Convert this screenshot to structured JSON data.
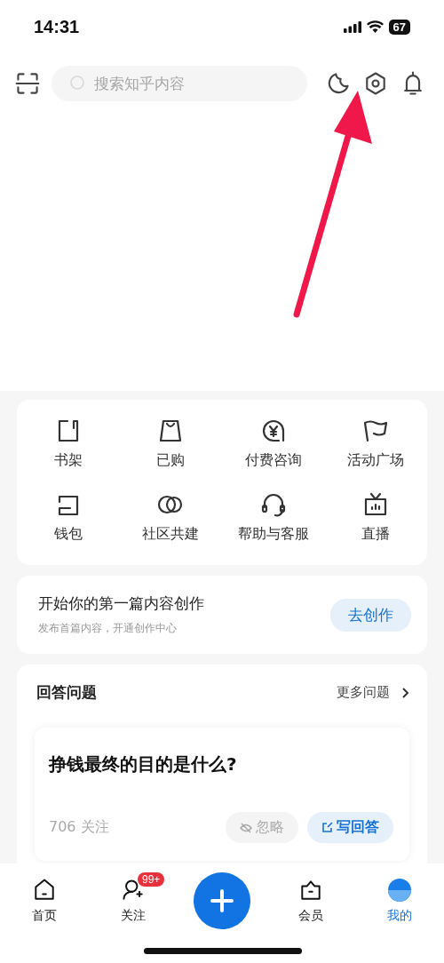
{
  "status_bar": {
    "time": "14:31",
    "battery": "67"
  },
  "search": {
    "placeholder": "搜索知乎内容"
  },
  "shortcuts": [
    {
      "label": "书架"
    },
    {
      "label": "已购"
    },
    {
      "label": "付费咨询"
    },
    {
      "label": "活动广场"
    },
    {
      "label": "钱包"
    },
    {
      "label": "社区共建"
    },
    {
      "label": "帮助与客服"
    },
    {
      "label": "直播"
    }
  ],
  "create_card": {
    "title": "开始你的第一篇内容创作",
    "subtitle": "发布首篇内容，开通创作中心",
    "button": "去创作"
  },
  "answer_section": {
    "title": "回答问题",
    "more": "更多问题",
    "question": {
      "title": "挣钱最终的目的是什么?",
      "followers": "706 关注",
      "ignore": "忽略",
      "answer": "写回答"
    }
  },
  "tabs": [
    {
      "label": "首页",
      "selected": false
    },
    {
      "label": "关注",
      "selected": false,
      "badge": "99+"
    },
    {
      "label": "会员",
      "selected": false
    },
    {
      "label": "我的",
      "selected": true
    }
  ]
}
